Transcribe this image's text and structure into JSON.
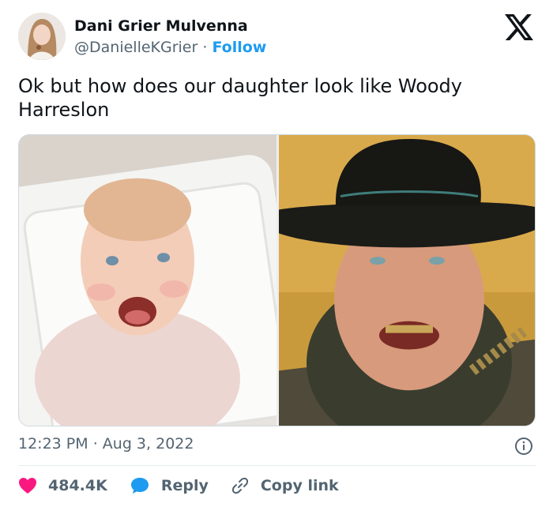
{
  "author": {
    "name": "Dani Grier Mulvenna",
    "handle": "@DanielleKGrier",
    "separator": "·",
    "follow_label": "Follow"
  },
  "tweet": {
    "text": "Ok but how does our daughter look like Woody Harreslon",
    "time": "12:23 PM",
    "separator": "·",
    "date": "Aug 3, 2022"
  },
  "actions": {
    "like_count": "484.4K",
    "reply_label": "Reply",
    "copy_label": "Copy link"
  },
  "icons": {
    "brand": "x-logo-icon",
    "info": "info-icon",
    "like": "heart-icon",
    "reply": "speech-bubble-icon",
    "copy": "link-icon"
  },
  "colors": {
    "accent": "#1d9bf0",
    "like": "#f91880",
    "muted": "#536471",
    "text": "#0f1419"
  }
}
